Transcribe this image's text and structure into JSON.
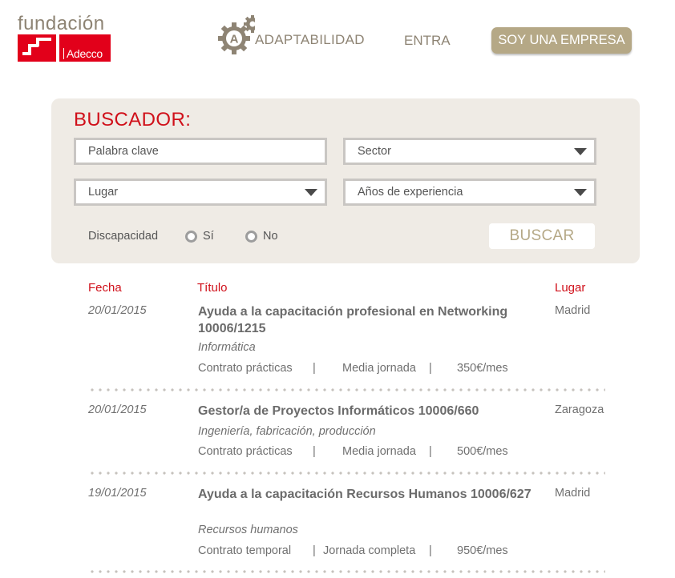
{
  "header": {
    "logo_word": "fundación",
    "logo_brand": "Adecco",
    "nav": {
      "adaptabilidad": "ADAPTABILIDAD",
      "gear_letter": "A",
      "entra": "ENTRA",
      "empresa": "SOY UNA EMPRESA"
    }
  },
  "search": {
    "title": "BUSCADOR:",
    "keyword_placeholder": "Palabra clave",
    "sector": "Sector",
    "lugar": "Lugar",
    "experiencia": "Años de experiencia",
    "discapacidad_label": "Discapacidad",
    "radio_si": "Sí",
    "radio_no": "No",
    "button": "BUSCAR"
  },
  "results": {
    "headers": {
      "fecha": "Fecha",
      "titulo": "Título",
      "lugar": "Lugar"
    },
    "rows": [
      {
        "date": "20/01/2015",
        "title": "Ayuda a la capacitación profesional en Networking 10006/1215",
        "place": "Madrid",
        "sector": "Informática",
        "contract": "Contrato prácticas",
        "sep1": "|",
        "schedule": "Media jornada",
        "sep2": "|",
        "salary": "350€/mes"
      },
      {
        "date": "20/01/2015",
        "title": "Gestor/a de Proyectos Informáticos 10006/660",
        "place": "Zaragoza",
        "sector": "Ingeniería, fabricación, producción",
        "contract": "Contrato prácticas",
        "sep1": "|",
        "schedule": "Media jornada",
        "sep2": "|",
        "salary": "500€/mes"
      },
      {
        "date": "19/01/2015",
        "title": "Ayuda a la capacitación Recursos Humanos 10006/627",
        "place": "Madrid",
        "sector": "Recursos humanos",
        "contract": "Contrato temporal",
        "sep1": "|",
        "schedule": "Jornada completa",
        "sep2": "|",
        "salary": "950€/mes"
      }
    ]
  },
  "colors": {
    "brand_red": "#e2001a",
    "accent_gold": "#b5a886",
    "panel_bg": "#efebe5"
  }
}
